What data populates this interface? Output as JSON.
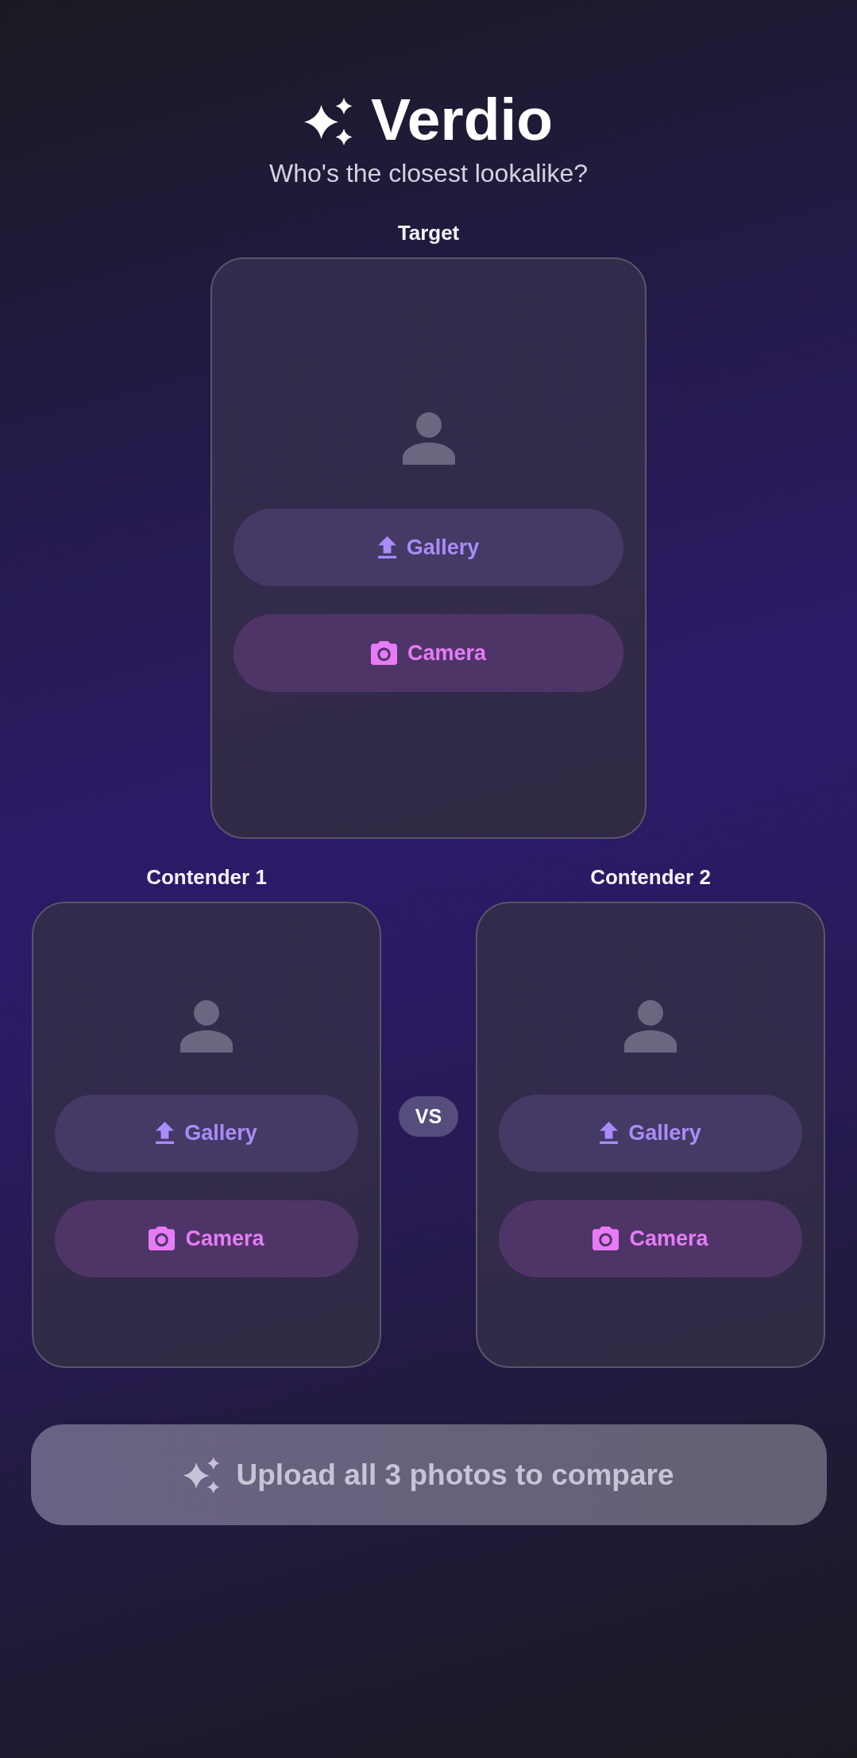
{
  "header": {
    "title": "Verdio",
    "subtitle": "Who's the closest lookalike?"
  },
  "target": {
    "label": "Target",
    "buttons": [
      {
        "kind": "gallery",
        "label": "Gallery"
      },
      {
        "kind": "camera",
        "label": "Camera"
      }
    ]
  },
  "contenders": [
    {
      "label": "Contender 1",
      "buttons": [
        {
          "kind": "gallery",
          "label": "Gallery"
        },
        {
          "kind": "camera",
          "label": "Camera"
        }
      ]
    },
    {
      "label": "Contender 2",
      "buttons": [
        {
          "kind": "gallery",
          "label": "Gallery"
        },
        {
          "kind": "camera",
          "label": "Camera"
        }
      ]
    }
  ],
  "versus": "VS",
  "compare_button": {
    "label": "Upload all 3 photos to compare",
    "disabled": true
  }
}
